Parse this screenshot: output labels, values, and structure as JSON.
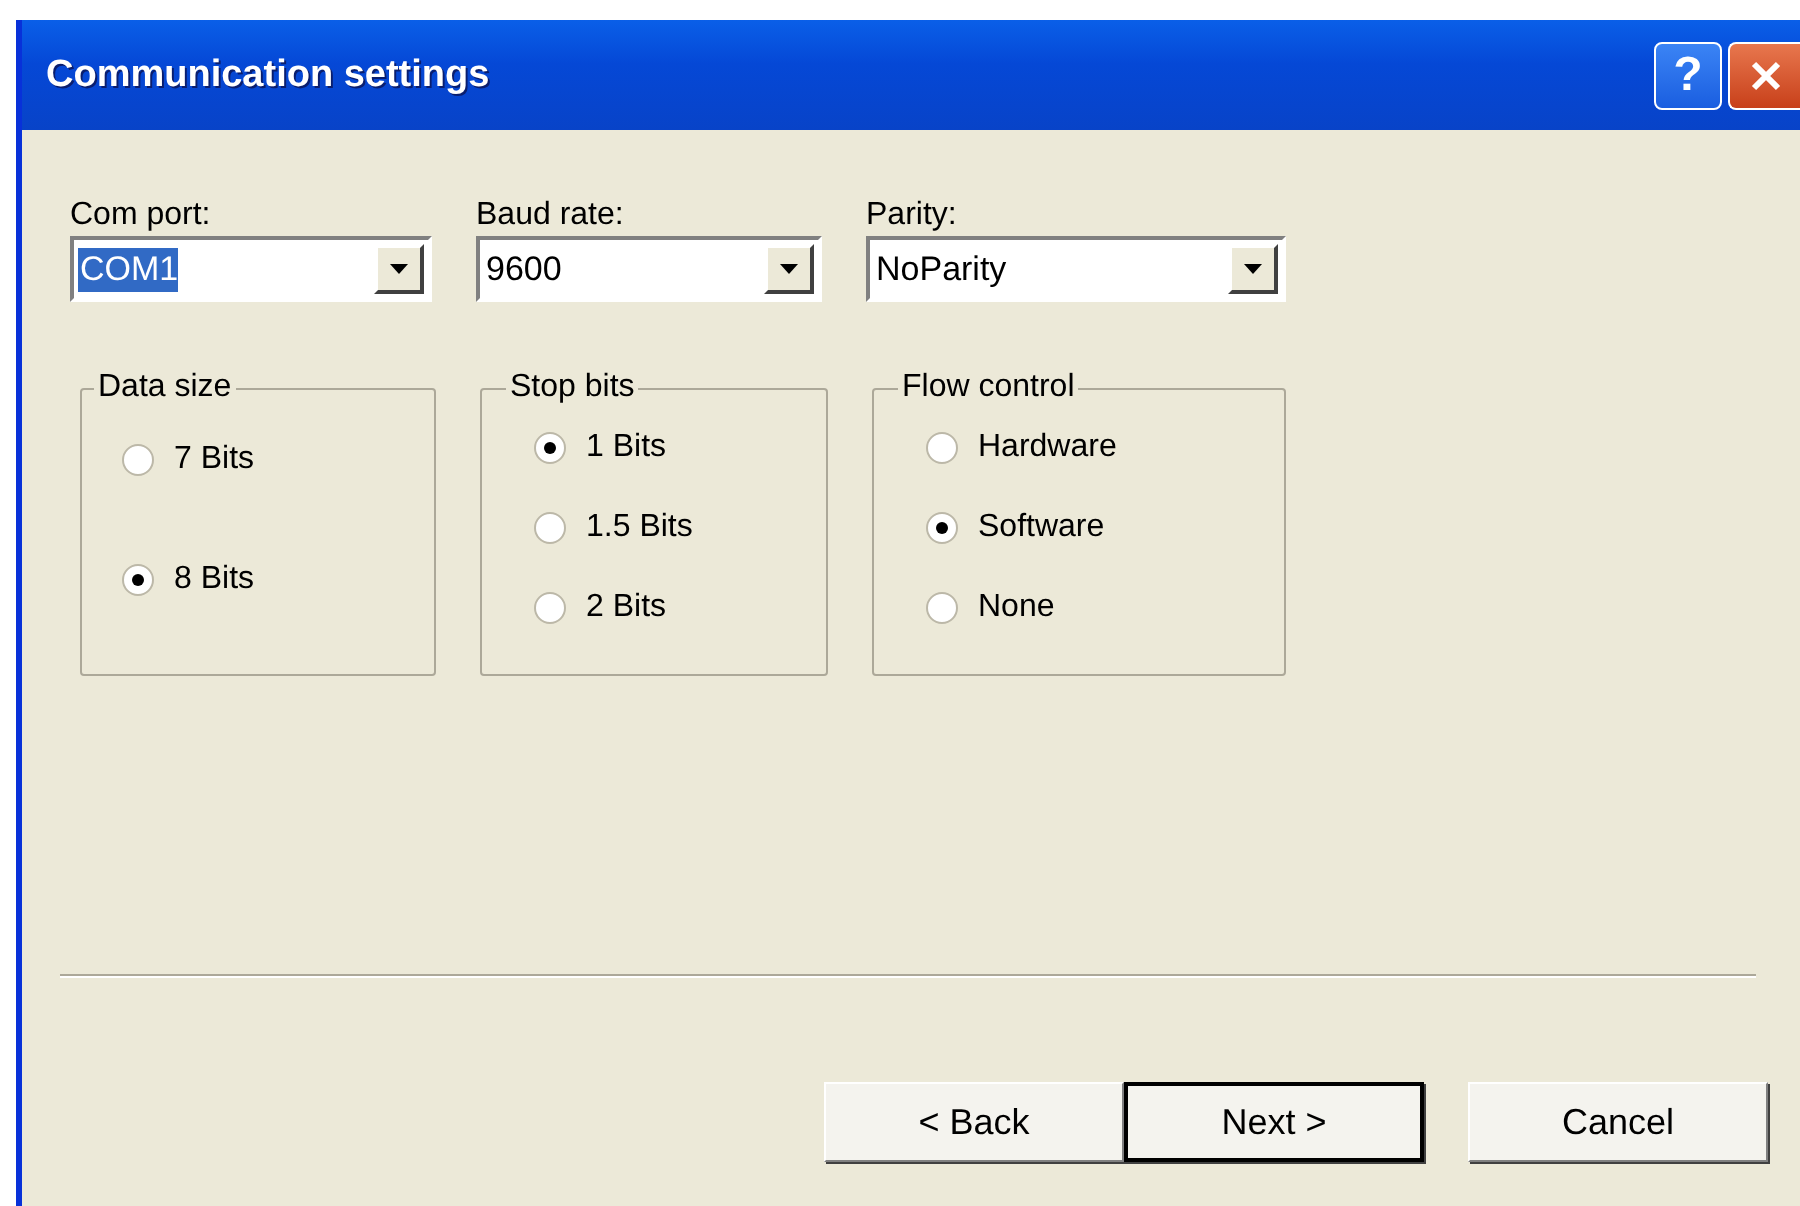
{
  "window": {
    "title": "Communication settings",
    "title_buttons": [
      {
        "kind": "help",
        "label": "?"
      },
      {
        "kind": "close"
      }
    ]
  },
  "dropdowns": [
    {
      "label": "Com port:",
      "value": "COM1",
      "highlighted": true
    },
    {
      "label": "Baud rate:",
      "value": "9600",
      "highlighted": false
    },
    {
      "label": "Parity:",
      "value": "NoParity",
      "highlighted": false
    }
  ],
  "groups": [
    {
      "title": "Data size",
      "spread": true,
      "options": [
        {
          "label": "7 Bits",
          "selected": false
        },
        {
          "label": "8 Bits",
          "selected": true
        }
      ]
    },
    {
      "title": "Stop bits",
      "spread": false,
      "options": [
        {
          "label": "1 Bits",
          "selected": true
        },
        {
          "label": "1.5 Bits",
          "selected": false
        },
        {
          "label": "2 Bits",
          "selected": false
        }
      ]
    },
    {
      "title": "Flow control",
      "spread": false,
      "options": [
        {
          "label": "Hardware",
          "selected": false
        },
        {
          "label": "Software",
          "selected": true
        },
        {
          "label": "None",
          "selected": false
        }
      ]
    }
  ],
  "buttons": [
    {
      "label": "< Back",
      "default": false
    },
    {
      "label": "Next >",
      "default": true
    },
    {
      "label": "Cancel",
      "default": false
    }
  ]
}
